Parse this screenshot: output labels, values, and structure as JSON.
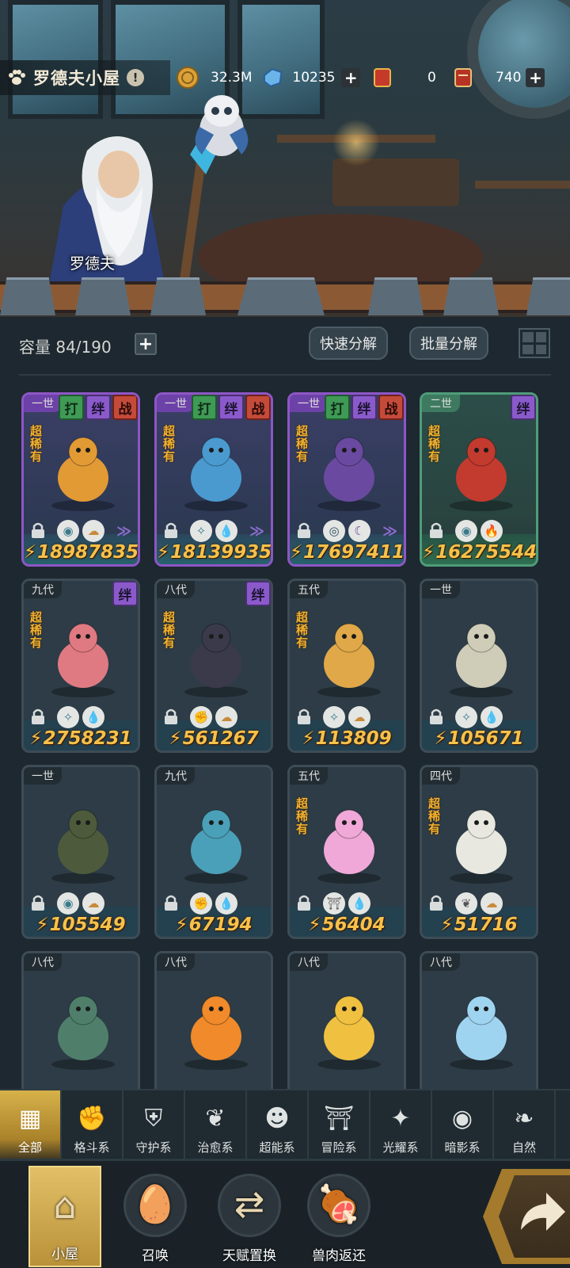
{
  "header": {
    "title": "罗德夫小屋",
    "info_icon": "!",
    "npc_name": "罗德夫",
    "resources": [
      {
        "icon": "gold-coin-icon",
        "value": "32.3M",
        "has_plus": false
      },
      {
        "icon": "blue-crystal-icon",
        "value": "10235",
        "has_plus": true
      },
      {
        "icon": "red-ticket-icon",
        "value": "0",
        "has_plus": false
      },
      {
        "icon": "red-scroll-icon",
        "value": "740",
        "has_plus": true
      }
    ]
  },
  "storage": {
    "capacity_label": "容量 84/190",
    "plus": "+",
    "quick_decompose": "快速分解",
    "batch_decompose": "批量分解"
  },
  "rarity_text": "超稀有",
  "cards": [
    {
      "gen": "一世",
      "tags": [
        "打",
        "绊",
        "战"
      ],
      "rare": true,
      "power": "18987835",
      "theme": "purple",
      "traits": [
        "eye-orb",
        "tan-blob"
      ],
      "monster": "#e29a35",
      "chev": true
    },
    {
      "gen": "一世",
      "tags": [
        "打",
        "绊",
        "战"
      ],
      "rare": true,
      "power": "18139935",
      "theme": "purple",
      "traits": [
        "light",
        "water"
      ],
      "monster": "#4a9ad0",
      "chev": true
    },
    {
      "gen": "一世",
      "tags": [
        "打",
        "绊",
        "战"
      ],
      "rare": true,
      "power": "17697411",
      "theme": "purple",
      "traits": [
        "eye",
        "moon"
      ],
      "monster": "#6a4aa0",
      "chev": true
    },
    {
      "gen": "二世",
      "tags": [
        "绊"
      ],
      "rare": true,
      "power": "16275544",
      "theme": "green",
      "traits": [
        "eye-orb",
        "fire"
      ],
      "monster": "#c33a2e",
      "chev": false
    },
    {
      "gen": "九代",
      "tags": [
        "绊"
      ],
      "rare": true,
      "power": "2758231",
      "theme": "dark",
      "traits": [
        "light",
        "water"
      ],
      "monster": "#e07a82",
      "chev": false
    },
    {
      "gen": "八代",
      "tags": [
        "绊"
      ],
      "rare": true,
      "power": "561267",
      "theme": "dark",
      "traits": [
        "fist",
        "tan-blob"
      ],
      "monster": "#3b3a4a",
      "chev": false
    },
    {
      "gen": "五代",
      "tags": [],
      "rare": true,
      "power": "113809",
      "theme": "dark",
      "traits": [
        "light",
        "tan-blob"
      ],
      "monster": "#e0a848",
      "chev": false
    },
    {
      "gen": "一世",
      "tags": [],
      "rare": false,
      "power": "105671",
      "theme": "dark",
      "traits": [
        "light",
        "water"
      ],
      "monster": "#cfcdb8",
      "chev": false
    },
    {
      "gen": "一世",
      "tags": [],
      "rare": false,
      "power": "105549",
      "theme": "dark",
      "traits": [
        "eye-orb",
        "tan-blob"
      ],
      "monster": "#4d5a3c",
      "chev": false
    },
    {
      "gen": "九代",
      "tags": [],
      "rare": false,
      "power": "67194",
      "theme": "dark",
      "traits": [
        "fist",
        "water"
      ],
      "monster": "#4aa0b8",
      "chev": false
    },
    {
      "gen": "五代",
      "tags": [],
      "rare": true,
      "power": "56404",
      "theme": "dark",
      "traits": [
        "shrine",
        "water"
      ],
      "monster": "#f0a8d8",
      "chev": false
    },
    {
      "gen": "四代",
      "tags": [],
      "rare": true,
      "power": "51716",
      "theme": "dark",
      "traits": [
        "leaf",
        "tan-blob"
      ],
      "monster": "#e8e8e0",
      "chev": false
    },
    {
      "gen": "八代",
      "tags": [],
      "rare": false,
      "power": "",
      "theme": "dark",
      "traits": [],
      "monster": "#4f7f6a",
      "chev": false
    },
    {
      "gen": "八代",
      "tags": [],
      "rare": false,
      "power": "",
      "theme": "dark",
      "traits": [],
      "monster": "#f08a2a",
      "chev": false
    },
    {
      "gen": "八代",
      "tags": [],
      "rare": false,
      "power": "",
      "theme": "dark",
      "traits": [],
      "monster": "#f0c040",
      "chev": false
    },
    {
      "gen": "八代",
      "tags": [],
      "rare": false,
      "power": "",
      "theme": "dark",
      "traits": [],
      "monster": "#9fd4f0",
      "chev": false
    }
  ],
  "categories": [
    {
      "label": "全部",
      "icon": "all-blocks-icon",
      "active": true
    },
    {
      "label": "格斗系",
      "icon": "fist-icon",
      "active": false
    },
    {
      "label": "守护系",
      "icon": "shield-icon",
      "active": false
    },
    {
      "label": "治愈系",
      "icon": "sprout-icon",
      "active": false
    },
    {
      "label": "超能系",
      "icon": "psychic-head-icon",
      "active": false
    },
    {
      "label": "冒险系",
      "icon": "shrine-icon",
      "active": false
    },
    {
      "label": "光耀系",
      "icon": "star-compass-icon",
      "active": false
    },
    {
      "label": "暗影系",
      "icon": "eye-shadow-icon",
      "active": false
    },
    {
      "label": "自然",
      "icon": "nature-leaf-icon",
      "active": false
    }
  ],
  "bottom_nav": [
    {
      "label": "小屋",
      "icon": "hut-icon",
      "active": true
    },
    {
      "label": "召唤",
      "icon": "egg-icon",
      "active": false
    },
    {
      "label": "天赋置换",
      "icon": "swap-arrows-icon",
      "active": false
    },
    {
      "label": "兽肉返还",
      "icon": "meat-icon",
      "active": false
    }
  ],
  "colors": {
    "bg": "#1d2830",
    "power": "#f6c14a",
    "rare": "#f2b12e",
    "tag_bond": "#8a5acb",
    "tag_fight": "#3e9a55",
    "tag_war": "#c44a3a",
    "active_tab": "#d7b24a"
  }
}
